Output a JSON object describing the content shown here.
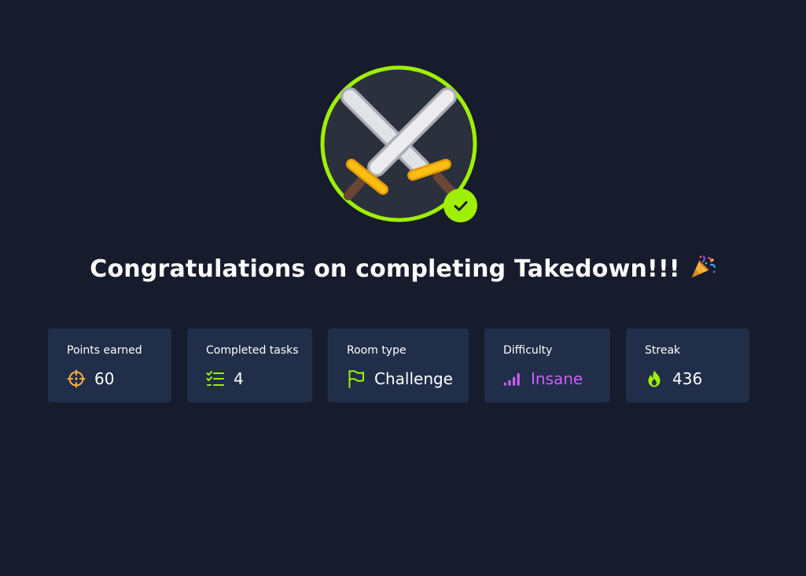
{
  "completion": {
    "headline": "Congratulations on completing Takedown!!!",
    "celebration_icon": "party-popper-icon",
    "badge_icon": "crossed-swords-icon",
    "check_icon": "checkmark-icon"
  },
  "stats": [
    {
      "label": "Points earned",
      "value": "60",
      "icon": "target-icon",
      "icon_color": "#ffb03b"
    },
    {
      "label": "Completed tasks",
      "value": "4",
      "icon": "task-list-icon",
      "icon_color": "#9fef00"
    },
    {
      "label": "Room type",
      "value": "Challenge",
      "icon": "flag-icon",
      "icon_color": "#9fef00"
    },
    {
      "label": "Difficulty",
      "value": "Insane",
      "icon": "signal-bars-icon",
      "icon_color": "#cf5dff"
    },
    {
      "label": "Streak",
      "value": "436",
      "icon": "flame-icon",
      "icon_color": "#9fef00"
    }
  ],
  "colors": {
    "background": "#161c2b",
    "card": "#212e4a",
    "accent_green": "#9fef00",
    "difficulty_purple": "#cf5dff",
    "points_orange": "#ffb03b"
  }
}
